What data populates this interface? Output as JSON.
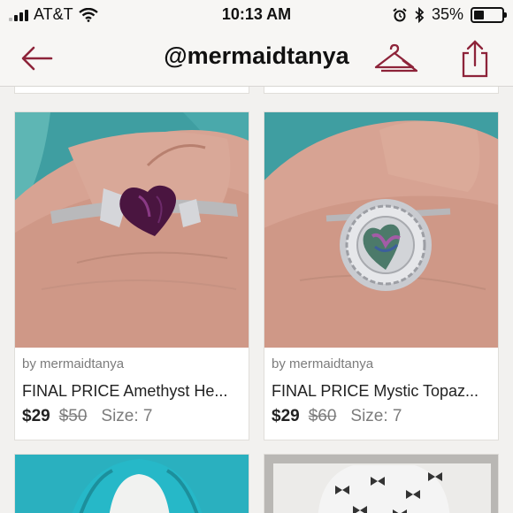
{
  "status": {
    "carrier": "AT&T",
    "time": "10:13 AM",
    "battery": "35%",
    "battery_level": 0.35
  },
  "nav": {
    "title": "@mermaidtanya",
    "back_icon": "arrow-left-icon",
    "closet_icon": "hanger-icon",
    "share_icon": "share-icon",
    "accent": "#8d2339"
  },
  "listings": [
    {
      "seller": "by mermaidtanya",
      "title": "FINAL PRICE Amethyst He...",
      "price": "$29",
      "original_price": "$50",
      "size": "Size: 7"
    },
    {
      "seller": "by mermaidtanya",
      "title": "FINAL PRICE Mystic Topaz...",
      "price": "$29",
      "original_price": "$60",
      "size": "Size: 7"
    }
  ]
}
